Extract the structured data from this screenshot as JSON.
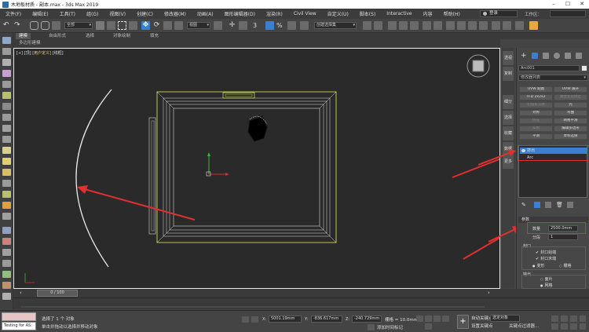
{
  "window": {
    "title": "木地板材质 - 副本.max - 3ds Max 2019"
  },
  "menu": {
    "items": [
      "文件(F)",
      "编辑(E)",
      "工具(T)",
      "组(G)",
      "视图(V)",
      "创建(C)",
      "修改器(M)",
      "动画(A)",
      "图形编辑器(D)",
      "渲染(R)",
      "Civil View",
      "自定义(U)",
      "脚本(S)",
      "Interactive",
      "内容",
      "帮助(H)"
    ],
    "login": "登录",
    "workspace": "工作区："
  },
  "toolbar": {
    "filter_select": "全部",
    "view_select": "视图",
    "selection_set": "创建选择集"
  },
  "ribbon": {
    "tabs": [
      "建模",
      "自由形式",
      "选择",
      "对象绘制",
      "填充"
    ],
    "sub_label": "多边形建模"
  },
  "viewport": {
    "label_open": "[+]",
    "label_view": "[顶]",
    "label_shading": "[用户定义]",
    "label_mode": "[线框]"
  },
  "right_tabs": [
    "透视",
    "复制",
    "细分",
    "选择",
    "收藏",
    "数据",
    "更多"
  ],
  "command_panel": {
    "object_name": "Arc001",
    "modifier_list": "修改器列表",
    "modifier_buttons": [
      [
        "UVW 贴图",
        "UVW 展开"
      ],
      [
        "FFD 2x2x2",
        "路径变形绑定"
      ],
      [
        "切角长方体",
        "壳"
      ],
      [
        "对称",
        "弯曲"
      ],
      [
        "挤压",
        "网格平滑"
      ],
      [
        "车削",
        "编辑多边形"
      ],
      [
        "平滑",
        "体积选择"
      ]
    ],
    "modifier_extra": "顶点焊接/选择",
    "stack": [
      {
        "label": "挤出",
        "selected": true
      },
      {
        "label": "Arc",
        "selected": false
      }
    ],
    "params_title": "参数",
    "amount_label": "数量",
    "amount_value": "2500.0mm",
    "segments_label": "分段",
    "segments_value": "1",
    "cap_label": "封口",
    "cap_start": "封口始端",
    "cap_end": "封口末端",
    "morph": "变形",
    "grid": "栅格",
    "output_label": "输出",
    "output_patch": "面片",
    "output_mesh": "网格"
  },
  "timeline": {
    "frame": "0 / 100"
  },
  "status": {
    "testing": "Testing for AS:",
    "line1": "选择了 1 个 对象",
    "line2": "单击并拖动以选择并移动对象",
    "x_value": "5001.19mm",
    "y_value": "-836.617mm",
    "z_value": "-240.729mm",
    "grid": "栅格 = 10.0mm",
    "add_time_tag": "添加时间标记",
    "auto_key": "自动关键点",
    "set_key": "设置关键点",
    "selected_object": "选定对象",
    "key_filter": "关键点过滤器..."
  },
  "colors": {
    "accent": "#3b7fd0",
    "arrow": "#e03030",
    "highlight_box": "#e03030",
    "object_line": "#c8d84a"
  },
  "annotations": {
    "arrow_count": 3
  }
}
